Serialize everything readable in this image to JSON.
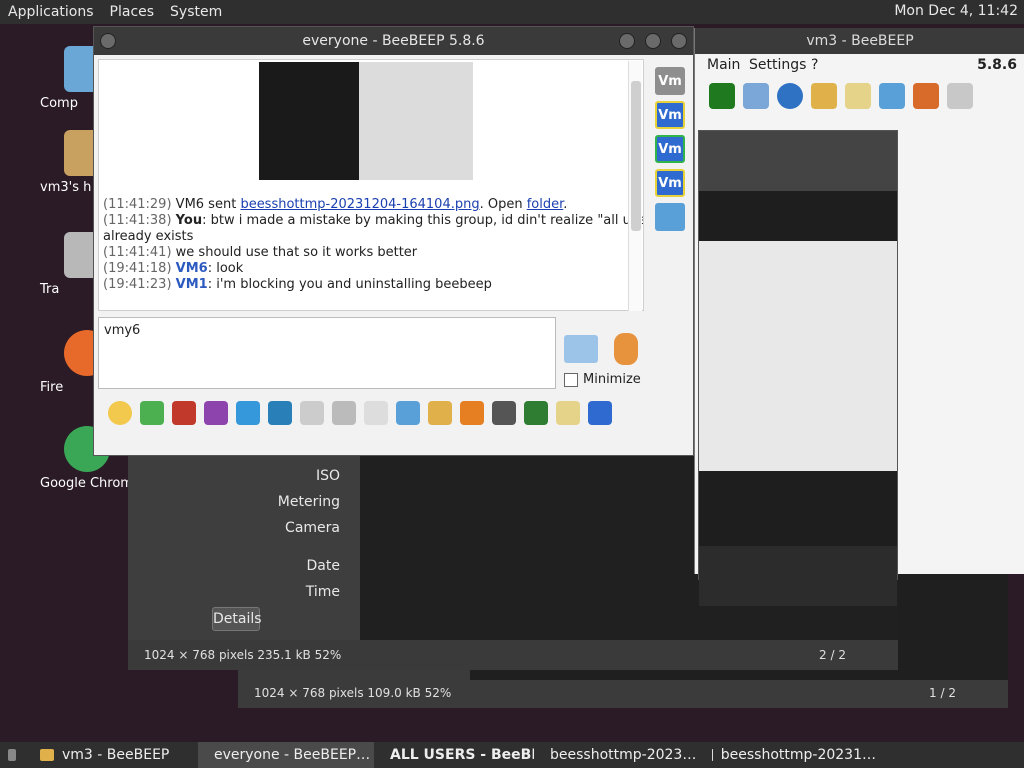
{
  "topbar": {
    "menus": [
      "Applications",
      "Places",
      "System"
    ],
    "clock": "Mon Dec 4, 11:42"
  },
  "desktop": {
    "icons": [
      "Comp",
      "vm3's h",
      "Tra",
      "Fire",
      "Google Chrom"
    ]
  },
  "viewer_back": {
    "status": "1024 × 768 pixels  109.0 kB   52%",
    "page": "1 / 2"
  },
  "viewer_front": {
    "labels": [
      "ISO",
      "Metering",
      "Camera",
      "Date",
      "Time"
    ],
    "details_button": "Details",
    "status": "1024 × 768 pixels  235.1 kB   52%",
    "page": "2 / 2"
  },
  "vm3": {
    "title": "vm3 - BeeBEEP",
    "menu": [
      "Main",
      "Settings",
      "?"
    ],
    "version": "5.8.6"
  },
  "main": {
    "title": "everyone - BeeBEEP 5.8.6",
    "messages": [
      {
        "ts": "(11:41:29)",
        "text": " VM6 sent ",
        "link": "beesshottmp-20231204-164104.png",
        "suffix": ". Open ",
        "link2": "folder",
        "end": "."
      },
      {
        "ts": "(11:41:38)",
        "sender": "You",
        "text": ": btw i made a mistake by making this group, id din't realize \"all users\""
      },
      {
        "ts": "",
        "text": "already exists"
      },
      {
        "ts": "(11:41:41)",
        "text": "   we should use that so it works better"
      },
      {
        "ts": "(19:41:18)",
        "sender": "VM6",
        "text": ": look"
      },
      {
        "ts": "(19:41:23)",
        "sender": "VM1",
        "text": ": i'm blocking you and uninstalling   beebeep"
      }
    ],
    "input_value": "vmy6",
    "minimize_label": "Minimize",
    "side_buttons": [
      "Vm",
      "Vm",
      "Vm",
      "Vm"
    ]
  },
  "taskbar": {
    "items": [
      "vm3 - BeeBEEP",
      "everyone - BeeBEEP…",
      "ALL USERS - BeeBE…",
      "beesshottmp-2023…",
      "beesshottmp-20231…"
    ]
  }
}
